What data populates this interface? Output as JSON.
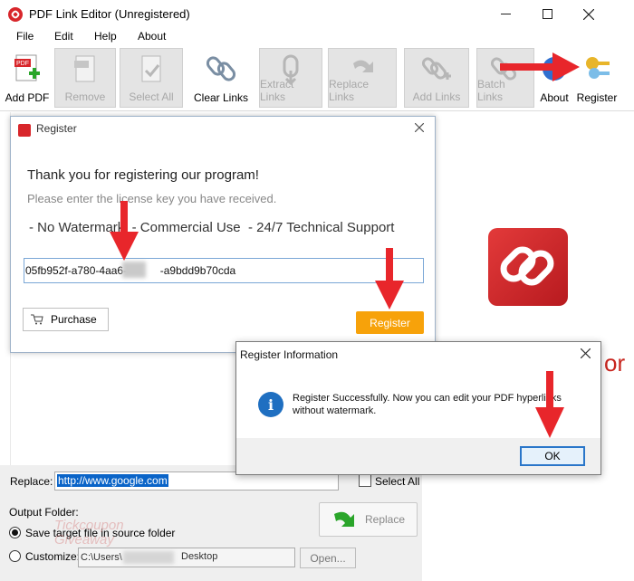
{
  "window": {
    "title": "PDF Link Editor (Unregistered)"
  },
  "menu": [
    "File",
    "Edit",
    "Help",
    "About"
  ],
  "toolbar": {
    "buttons": [
      {
        "label": "Add PDF",
        "icon": "add-pdf-icon",
        "enabled": true
      },
      {
        "label": "Remove",
        "icon": "remove-icon",
        "enabled": false
      },
      {
        "label": "Select All",
        "icon": "select-all-icon",
        "enabled": false
      },
      {
        "label": "Clear Links",
        "icon": "clear-links-icon",
        "enabled": true
      },
      {
        "label": "Extract Links",
        "icon": "extract-links-icon",
        "enabled": false
      },
      {
        "label": "Replace Links",
        "icon": "replace-links-icon",
        "enabled": false
      },
      {
        "label": "Add Links",
        "icon": "add-links-icon",
        "enabled": false
      },
      {
        "label": "Batch Links",
        "icon": "batch-links-icon",
        "enabled": false
      },
      {
        "label": "About",
        "icon": "about-globe-icon",
        "enabled": true
      },
      {
        "label": "Register",
        "icon": "register-keys-icon",
        "enabled": true
      }
    ]
  },
  "register_dialog": {
    "title": "Register",
    "thanks": "Thank you for registering our program!",
    "enter_prompt": "Please enter the license key you have received.",
    "features": "- No Watermark  - Commercial Use  - 24/7 Technical Support",
    "key_value": "05fb952f-a780-4aa6-           -a9bdd9b70cda",
    "purchase_label": "Purchase",
    "register_label": "Register"
  },
  "info_dialog": {
    "title": "Register Information",
    "message": "Register Successfully. Now you can edit your PDF hyperlinks without watermark.",
    "ok_label": "OK"
  },
  "background": {
    "partial_text": "or"
  },
  "bottom": {
    "replace_label": "Replace:",
    "replace_value": "http://www.google.com",
    "select_all_label": "Select All",
    "output_folder_label": "Output Folder:",
    "save_source_label": "Save target file in source folder",
    "customize_label": "Customize:",
    "path_prefix": "C:\\Users\\",
    "path_suffix": "Desktop",
    "open_label": "Open...",
    "replace_button_label": "Replace",
    "watermark_line1": "Tickcoupon",
    "watermark_line2": "Giveaway"
  },
  "colors": {
    "accent_orange": "#f7a20a",
    "arrow_red": "#e8262b",
    "info_blue": "#1f6fc1",
    "brand_red": "#d8262b"
  }
}
